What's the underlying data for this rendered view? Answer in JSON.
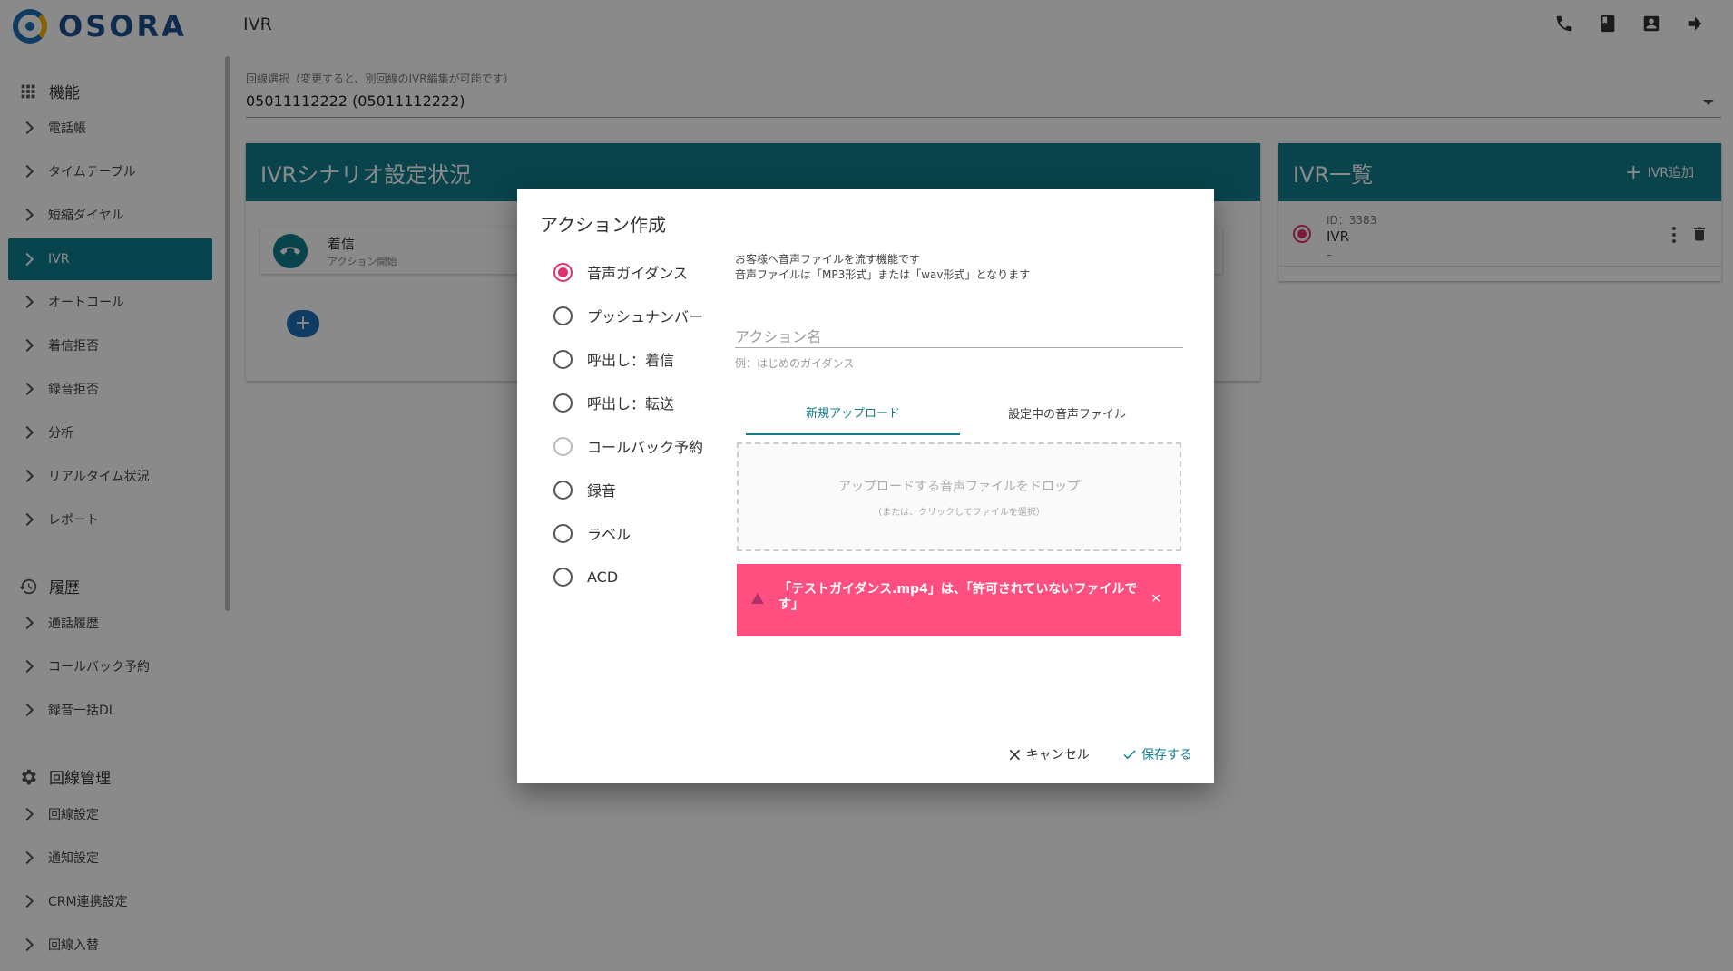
{
  "app": {
    "logo_text": "OSORA",
    "page_title": "IVR"
  },
  "sidebar": {
    "sections": [
      {
        "title": "機能",
        "icon": "grid-icon"
      },
      {
        "title": "履歴",
        "icon": "history-icon"
      },
      {
        "title": "回線管理",
        "icon": "gear-icon"
      }
    ],
    "features": [
      "電話帳",
      "タイムテーブル",
      "短縮ダイヤル",
      "IVR",
      "オートコール",
      "着信拒否",
      "録音拒否",
      "分析",
      "リアルタイム状況",
      "レポート"
    ],
    "history": [
      "通話履歴",
      "コールバック予約",
      "録音一括DL"
    ],
    "line_mgmt": [
      "回線設定",
      "通知設定",
      "CRM連携設定",
      "回線入替"
    ],
    "active": "IVR"
  },
  "line_select": {
    "label": "回線選択（変更すると、別回線のIVR編集が可能です）",
    "value": "05011112222 (05011112222)"
  },
  "scenario_panel": {
    "title": "IVRシナリオ設定状況",
    "node_title": "着信",
    "node_sub": "アクション開始",
    "add_label": "+"
  },
  "ivr_list": {
    "title": "IVR一覧",
    "add_label": "IVR追加",
    "items": [
      {
        "id": "ID：3383",
        "name": "IVR",
        "sub": "–"
      }
    ]
  },
  "dialog": {
    "title": "アクション作成",
    "options": [
      {
        "label": "音声ガイダンス",
        "state": "checked"
      },
      {
        "label": "プッシュナンバー",
        "state": "normal"
      },
      {
        "label": "呼出し：着信",
        "state": "normal"
      },
      {
        "label": "呼出し：転送",
        "state": "normal"
      },
      {
        "label": "コールバック予約",
        "state": "disabled"
      },
      {
        "label": "録音",
        "state": "normal"
      },
      {
        "label": "ラベル",
        "state": "normal"
      },
      {
        "label": "ACD",
        "state": "normal"
      }
    ],
    "desc_line1": "お客様へ音声ファイルを流す機能です",
    "desc_line2": "音声ファイルは「MP3形式」または「wav形式」となります",
    "name_placeholder": "アクション名",
    "name_hint": "例：はじめのガイダンス",
    "tabs": [
      "新規アップロード",
      "設定中の音声ファイル"
    ],
    "active_tab": 0,
    "dropzone_main": "アップロードする音声ファイルをドロップ",
    "dropzone_sub": "（または、クリックしてファイルを選択）",
    "alert_text": "「テストガイダンス.mp4」は、「許可されていないファイルです」",
    "alert_close": "×",
    "cancel_label": "キャンセル",
    "save_label": "保存する"
  },
  "colors": {
    "teal": "#117e8c",
    "pink": "#ff4f81",
    "radio": "#e0336e",
    "blue": "#1e6fb8"
  }
}
